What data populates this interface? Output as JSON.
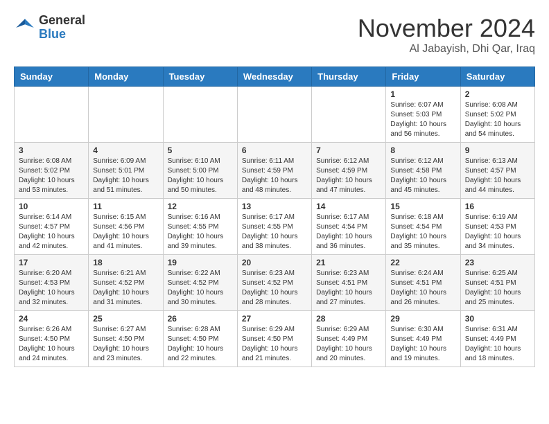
{
  "header": {
    "logo_general": "General",
    "logo_blue": "Blue",
    "month": "November 2024",
    "location": "Al Jabayish, Dhi Qar, Iraq"
  },
  "weekdays": [
    "Sunday",
    "Monday",
    "Tuesday",
    "Wednesday",
    "Thursday",
    "Friday",
    "Saturday"
  ],
  "weeks": [
    [
      {
        "day": "",
        "info": ""
      },
      {
        "day": "",
        "info": ""
      },
      {
        "day": "",
        "info": ""
      },
      {
        "day": "",
        "info": ""
      },
      {
        "day": "",
        "info": ""
      },
      {
        "day": "1",
        "info": "Sunrise: 6:07 AM\nSunset: 5:03 PM\nDaylight: 10 hours\nand 56 minutes."
      },
      {
        "day": "2",
        "info": "Sunrise: 6:08 AM\nSunset: 5:02 PM\nDaylight: 10 hours\nand 54 minutes."
      }
    ],
    [
      {
        "day": "3",
        "info": "Sunrise: 6:08 AM\nSunset: 5:02 PM\nDaylight: 10 hours\nand 53 minutes."
      },
      {
        "day": "4",
        "info": "Sunrise: 6:09 AM\nSunset: 5:01 PM\nDaylight: 10 hours\nand 51 minutes."
      },
      {
        "day": "5",
        "info": "Sunrise: 6:10 AM\nSunset: 5:00 PM\nDaylight: 10 hours\nand 50 minutes."
      },
      {
        "day": "6",
        "info": "Sunrise: 6:11 AM\nSunset: 4:59 PM\nDaylight: 10 hours\nand 48 minutes."
      },
      {
        "day": "7",
        "info": "Sunrise: 6:12 AM\nSunset: 4:59 PM\nDaylight: 10 hours\nand 47 minutes."
      },
      {
        "day": "8",
        "info": "Sunrise: 6:12 AM\nSunset: 4:58 PM\nDaylight: 10 hours\nand 45 minutes."
      },
      {
        "day": "9",
        "info": "Sunrise: 6:13 AM\nSunset: 4:57 PM\nDaylight: 10 hours\nand 44 minutes."
      }
    ],
    [
      {
        "day": "10",
        "info": "Sunrise: 6:14 AM\nSunset: 4:57 PM\nDaylight: 10 hours\nand 42 minutes."
      },
      {
        "day": "11",
        "info": "Sunrise: 6:15 AM\nSunset: 4:56 PM\nDaylight: 10 hours\nand 41 minutes."
      },
      {
        "day": "12",
        "info": "Sunrise: 6:16 AM\nSunset: 4:55 PM\nDaylight: 10 hours\nand 39 minutes."
      },
      {
        "day": "13",
        "info": "Sunrise: 6:17 AM\nSunset: 4:55 PM\nDaylight: 10 hours\nand 38 minutes."
      },
      {
        "day": "14",
        "info": "Sunrise: 6:17 AM\nSunset: 4:54 PM\nDaylight: 10 hours\nand 36 minutes."
      },
      {
        "day": "15",
        "info": "Sunrise: 6:18 AM\nSunset: 4:54 PM\nDaylight: 10 hours\nand 35 minutes."
      },
      {
        "day": "16",
        "info": "Sunrise: 6:19 AM\nSunset: 4:53 PM\nDaylight: 10 hours\nand 34 minutes."
      }
    ],
    [
      {
        "day": "17",
        "info": "Sunrise: 6:20 AM\nSunset: 4:53 PM\nDaylight: 10 hours\nand 32 minutes."
      },
      {
        "day": "18",
        "info": "Sunrise: 6:21 AM\nSunset: 4:52 PM\nDaylight: 10 hours\nand 31 minutes."
      },
      {
        "day": "19",
        "info": "Sunrise: 6:22 AM\nSunset: 4:52 PM\nDaylight: 10 hours\nand 30 minutes."
      },
      {
        "day": "20",
        "info": "Sunrise: 6:23 AM\nSunset: 4:52 PM\nDaylight: 10 hours\nand 28 minutes."
      },
      {
        "day": "21",
        "info": "Sunrise: 6:23 AM\nSunset: 4:51 PM\nDaylight: 10 hours\nand 27 minutes."
      },
      {
        "day": "22",
        "info": "Sunrise: 6:24 AM\nSunset: 4:51 PM\nDaylight: 10 hours\nand 26 minutes."
      },
      {
        "day": "23",
        "info": "Sunrise: 6:25 AM\nSunset: 4:51 PM\nDaylight: 10 hours\nand 25 minutes."
      }
    ],
    [
      {
        "day": "24",
        "info": "Sunrise: 6:26 AM\nSunset: 4:50 PM\nDaylight: 10 hours\nand 24 minutes."
      },
      {
        "day": "25",
        "info": "Sunrise: 6:27 AM\nSunset: 4:50 PM\nDaylight: 10 hours\nand 23 minutes."
      },
      {
        "day": "26",
        "info": "Sunrise: 6:28 AM\nSunset: 4:50 PM\nDaylight: 10 hours\nand 22 minutes."
      },
      {
        "day": "27",
        "info": "Sunrise: 6:29 AM\nSunset: 4:50 PM\nDaylight: 10 hours\nand 21 minutes."
      },
      {
        "day": "28",
        "info": "Sunrise: 6:29 AM\nSunset: 4:49 PM\nDaylight: 10 hours\nand 20 minutes."
      },
      {
        "day": "29",
        "info": "Sunrise: 6:30 AM\nSunset: 4:49 PM\nDaylight: 10 hours\nand 19 minutes."
      },
      {
        "day": "30",
        "info": "Sunrise: 6:31 AM\nSunset: 4:49 PM\nDaylight: 10 hours\nand 18 minutes."
      }
    ]
  ]
}
